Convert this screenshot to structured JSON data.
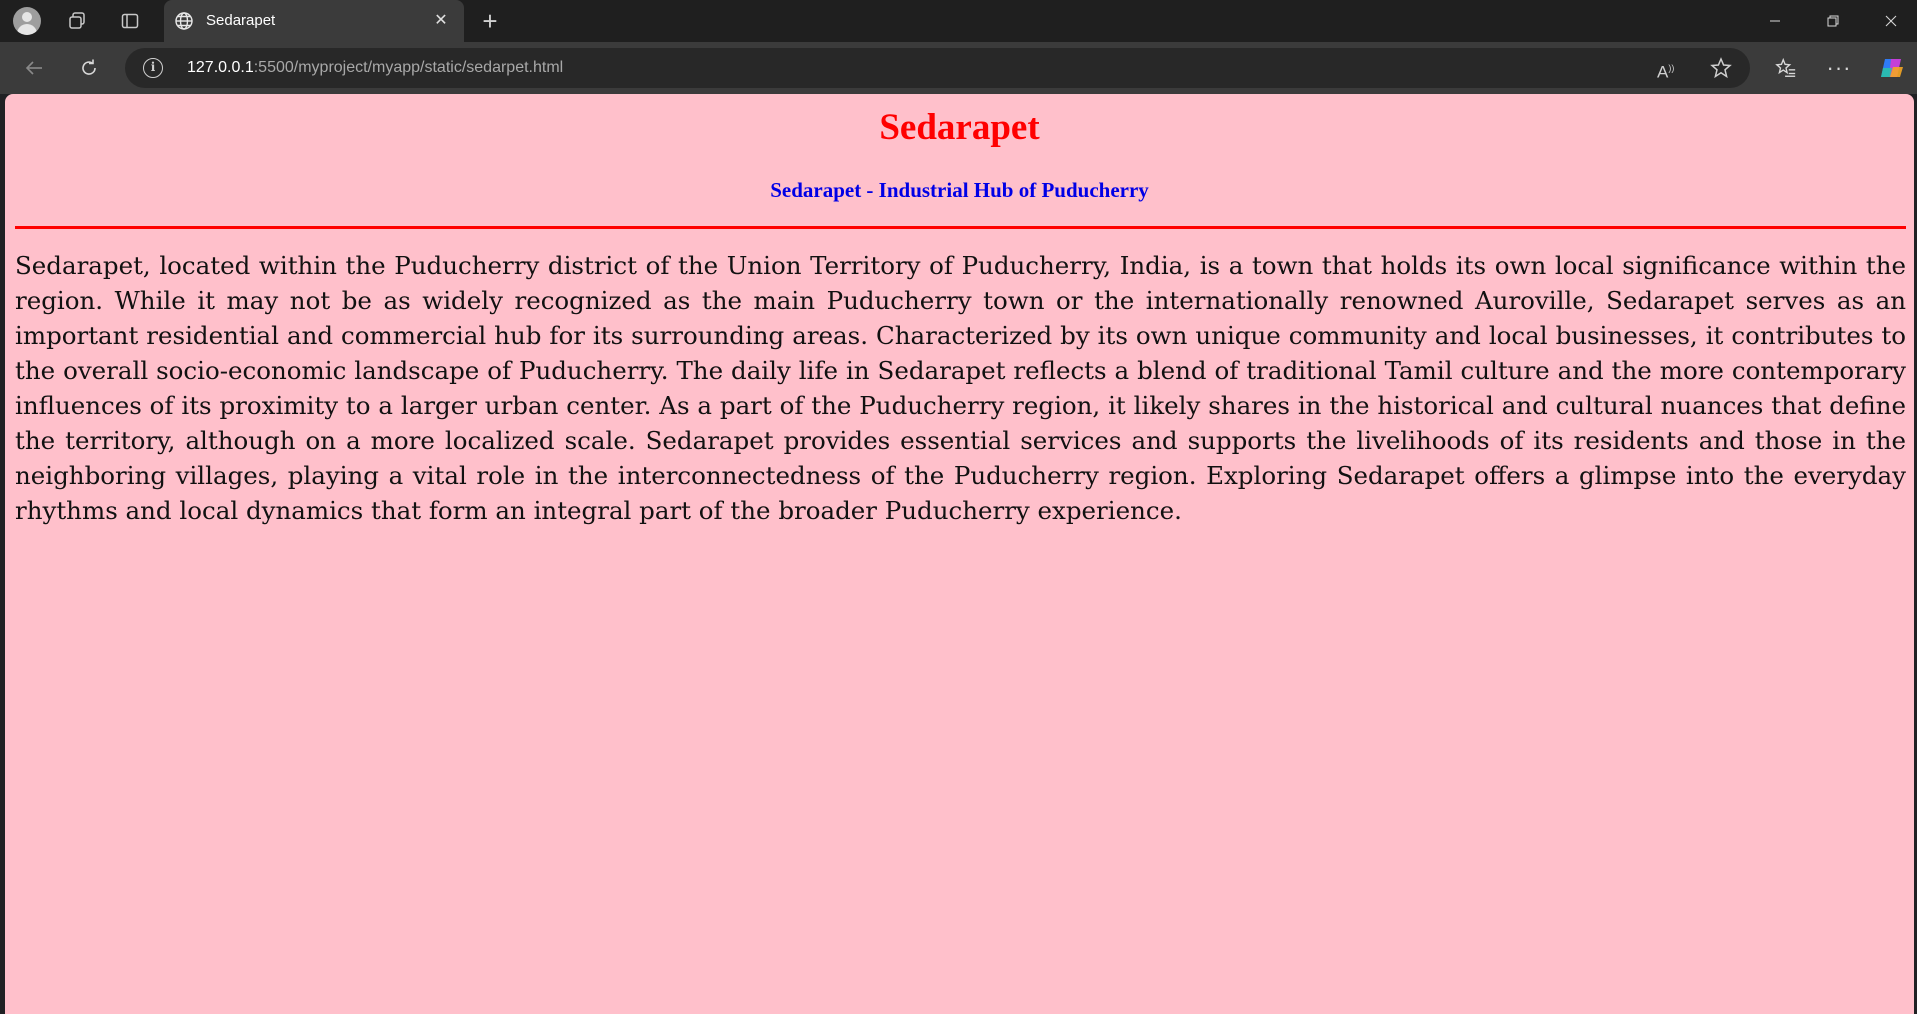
{
  "browser": {
    "tab": {
      "title": "Sedarapet",
      "icon": "globe-icon",
      "close_icon": "close-icon"
    },
    "new_tab_icon": "plus-icon",
    "address_bar": {
      "host": "127.0.0.1",
      "path": ":5500/myproject/myapp/static/sedarpet.html",
      "site_info_icon": "info-icon"
    },
    "window_controls": [
      "minimize-icon",
      "restore-icon",
      "close-icon"
    ]
  },
  "page": {
    "background_color": "#ffc0cb",
    "heading": "Sedarapet",
    "heading_color": "#ff0000",
    "subheading": "Sedarapet - Industrial Hub of Puducherry",
    "subheading_color": "#0000e6",
    "rule_color": "#ff0000",
    "paragraph": "Sedarapet, located within the Puducherry district of the Union Territory of Puducherry, India, is a town that holds its own local significance within the region. While it may not be as widely recognized as the main Puducherry town or the internationally renowned Auroville, Sedarapet serves as an important residential and commercial hub for its surrounding areas. Characterized by its own unique community and local businesses, it contributes to the overall socio-economic landscape of Puducherry. The daily life in Sedarapet reflects a blend of traditional Tamil culture and the more contemporary influences of its proximity to a larger urban center. As a part of the Puducherry region, it likely shares in the historical and cultural nuances that define the territory, although on a more localized scale. Sedarapet provides essential services and supports the livelihoods of its residents and those in the neighboring villages, playing a vital role in the interconnectedness of the Puducherry region. Exploring Sedarapet offers a glimpse into the everyday rhythms and local dynamics that form an integral part of the broader Puducherry experience."
  }
}
